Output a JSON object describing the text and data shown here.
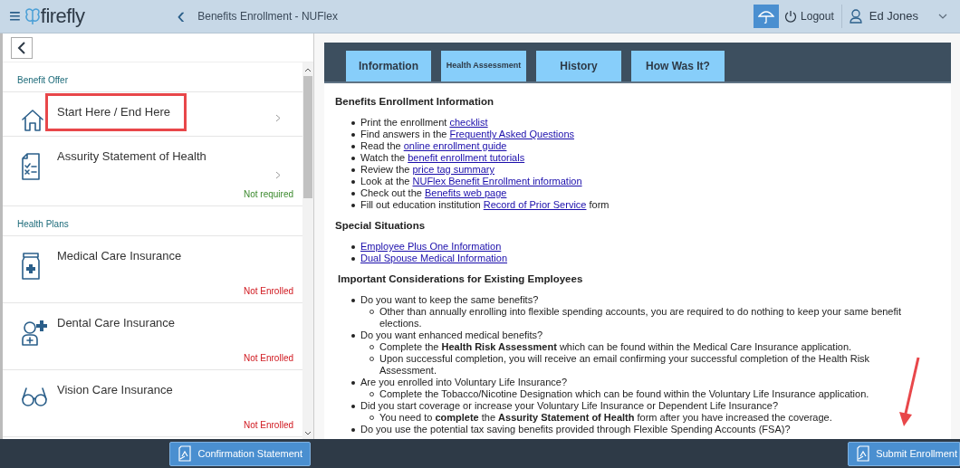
{
  "header": {
    "menu": "≡",
    "logo": "firefly",
    "back": "‹",
    "title": "Benefits Enrollment - NUFlex",
    "logout": "Logout",
    "user": "Ed Jones"
  },
  "sidebar": {
    "sections": [
      {
        "title": "Benefit Offer",
        "items": [
          {
            "title": "Start Here / End Here",
            "highlighted": true,
            "chevron": true
          },
          {
            "title": "Assurity Statement of Health",
            "status": "Not required",
            "kind": "ok",
            "highlighted": false,
            "chevron": true
          }
        ]
      },
      {
        "title": "Health Plans",
        "items": [
          {
            "title": "Medical Care Insurance",
            "status": "Not Enrolled",
            "kind": "missing",
            "highlighted": false,
            "chevron": false
          },
          {
            "title": "Dental Care Insurance",
            "status": "Not Enrolled",
            "kind": "missing",
            "highlighted": false,
            "chevron": false
          },
          {
            "title": "Vision Care Insurance",
            "status": "Not Enrolled",
            "kind": "missing",
            "highlighted": false,
            "chevron": false
          }
        ]
      }
    ]
  },
  "tabs": [
    {
      "label": "Information",
      "kind": "large"
    },
    {
      "label": "Health Assessment",
      "kind": "small"
    },
    {
      "label": "History",
      "kind": "large"
    },
    {
      "label": "How Was It?",
      "kind": "large"
    }
  ],
  "sections": [
    {
      "heading": "Benefits Enrollment Information",
      "items": [
        {
          "before": "Print the enrollment ",
          "link": "checklist"
        },
        {
          "before": "Find answers in the ",
          "link": "Frequently Asked Questions"
        },
        {
          "before": "Read the ",
          "link": "online enrollment guide"
        },
        {
          "before": "Watch the ",
          "link": "benefit enrollment tutorials"
        },
        {
          "before": "Review the ",
          "link": "price tag summary"
        },
        {
          "before": "Look at the ",
          "link": "NUFlex Benefit Enrollment information"
        },
        {
          "before": "Check out the ",
          "link": "Benefits web page"
        },
        {
          "before": "Fill out education institution ",
          "link": "Record of Prior Service",
          "after": " form"
        }
      ]
    },
    {
      "heading": "Special Situations",
      "items": [
        {
          "link": "Employee Plus One Information"
        },
        {
          "link": "Dual Spouse Medical Information"
        }
      ]
    },
    {
      "heading": "Important Considerations for Existing Employees",
      "items": [
        {
          "before": "Do you want to keep the same benefits?",
          "children": [
            "Other than annually enrolling into flexible spending accounts, you are required to do nothing to keep your same benefit elections."
          ]
        },
        {
          "before": "Do you want enhanced medical benefits?",
          "children": [
            "Complete the **Health Risk Assessment** which can be found within the Medical Care Insurance application.",
            "Upon successful completion, you will receive an email confirming your successful completion of the Health Risk Assessment."
          ]
        },
        {
          "before": "Are you enrolled into Voluntary Life Insurance?",
          "children": [
            "Complete the Tobacco/Nicotine Designation which can be found within the Voluntary Life Insurance application."
          ]
        },
        {
          "before": "Did you start coverage or increase your Voluntary Life Insurance or Dependent Life Insurance?",
          "children": [
            "You need to **complete** the **Assurity Statement of Health** form after you have increased the coverage."
          ]
        },
        {
          "before": "Do you use the potential tax saving benefits provided through Flexible Spending Accounts (FSA)?"
        }
      ]
    }
  ],
  "footer": {
    "left_button": "Confirmation Statement",
    "right_button": "Submit Enrollment"
  }
}
